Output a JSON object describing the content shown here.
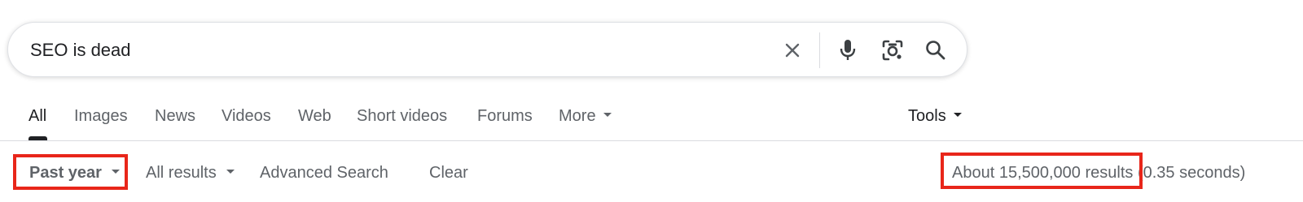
{
  "search": {
    "query": "SEO is dead",
    "clear_icon": "close-icon",
    "mic_icon": "microphone-icon",
    "lens_icon": "camera-lens-icon",
    "search_icon": "magnifier-icon"
  },
  "tabs": [
    {
      "label": "All",
      "active": true
    },
    {
      "label": "Images"
    },
    {
      "label": "News"
    },
    {
      "label": "Videos"
    },
    {
      "label": "Web"
    },
    {
      "label": "Short videos"
    },
    {
      "label": "Forums"
    },
    {
      "label": "More"
    }
  ],
  "tools_label": "Tools",
  "filters": {
    "time": "Past year",
    "results_type": "All results",
    "advanced": "Advanced Search",
    "clear": "Clear"
  },
  "stats": {
    "count": "About 15,500,000 results",
    "time": " (0.35 seconds)"
  },
  "colors": {
    "highlight": "#e8261a",
    "text_primary": "#202124",
    "text_secondary": "#5f6368",
    "border": "#dfe1e5"
  }
}
